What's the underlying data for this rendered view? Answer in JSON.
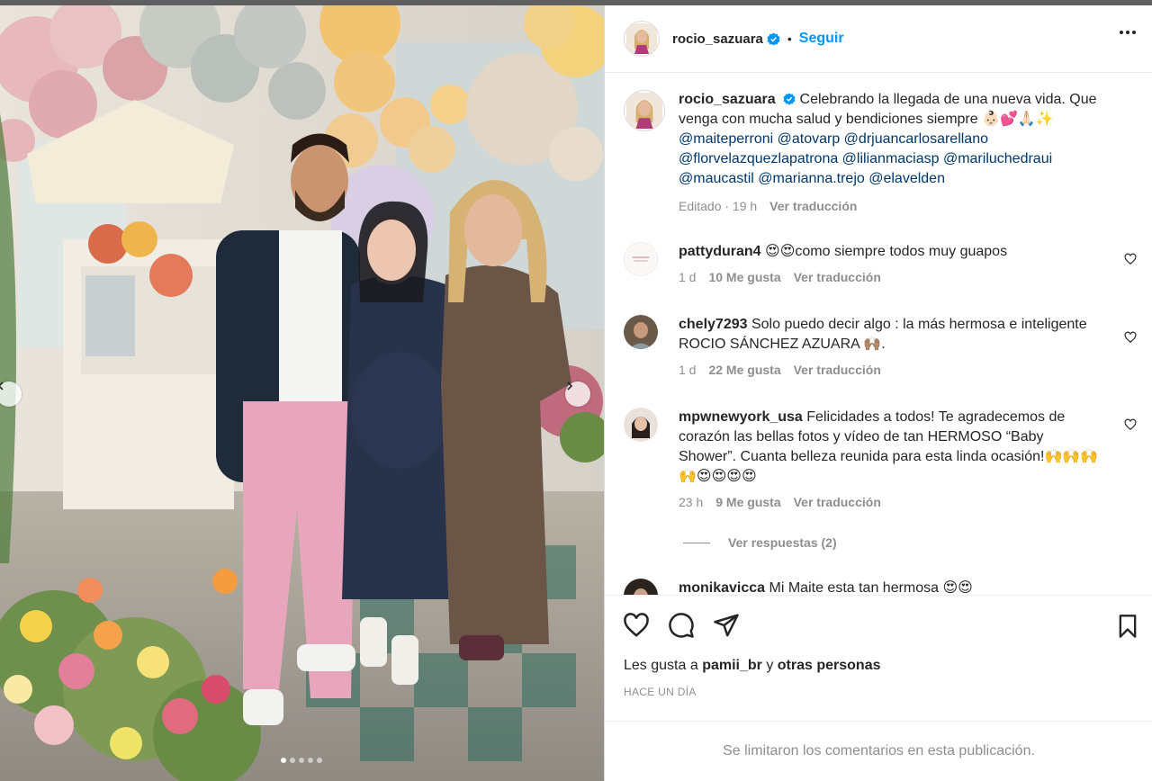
{
  "post": {
    "username": "rocio_sazuara",
    "follow_label": "Seguir",
    "separator": "•"
  },
  "caption": {
    "username": "rocio_sazuara",
    "text": "Celebrando la llegada de una nueva vida. Que venga con mucha salud y bendiciones siempre 👶🏻💕🙏🏻✨",
    "mentions_line1": "@maiteperroni @atovarp @drjuancarlosarellano",
    "mentions_line2": "@florvelazquezlapatrona @lilianmaciasp @mariluchedraui",
    "mentions_line3": "@maucastil @marianna.trejo @elavelden",
    "edited": "Editado · 19 h",
    "translate": "Ver traducción"
  },
  "comments": [
    {
      "username": "pattyduran4",
      "text": "😍😍como siempre todos muy guapos",
      "time": "1 d",
      "likes": "10 Me gusta",
      "translate": "Ver traducción"
    },
    {
      "username": "chely7293",
      "text": "Solo puedo decir algo : la más hermosa e inteligente ROCIO SÁNCHEZ AZUARA 🙌🏽.",
      "time": "1 d",
      "likes": "22 Me gusta",
      "translate": "Ver traducción"
    },
    {
      "username": "mpwnewyork_usa",
      "text": "Felicidades a todos! Te agradecemos de corazón las bellas fotos y vídeo de tan HERMOSO “Baby Shower”. Cuanta belleza reunida para esta linda ocasión!🙌🙌🙌🙌😍😍😍😍",
      "time": "23 h",
      "likes": "9 Me gusta",
      "translate": "Ver traducción",
      "replies": "Ver respuestas (2)"
    },
    {
      "username": "monikavicca",
      "text": "Mi Maite esta tan hermosa 😍😍"
    }
  ],
  "footer": {
    "likes_prefix": "Les gusta a",
    "likes_user": "pamii_br",
    "likes_and": "y",
    "likes_others": "otras personas",
    "when": "HACE UN DÍA",
    "comments_limited": "Se limitaron los comentarios en esta publicación."
  },
  "colors": {
    "link": "#0095f6",
    "mention": "#00376b",
    "muted": "#8e8e8e",
    "verified": "#0095f6"
  },
  "icons": [
    "chevron-left-icon",
    "chevron-right-icon",
    "verified-icon",
    "more-icon",
    "heart-icon",
    "comment-icon",
    "share-icon",
    "bookmark-icon"
  ]
}
